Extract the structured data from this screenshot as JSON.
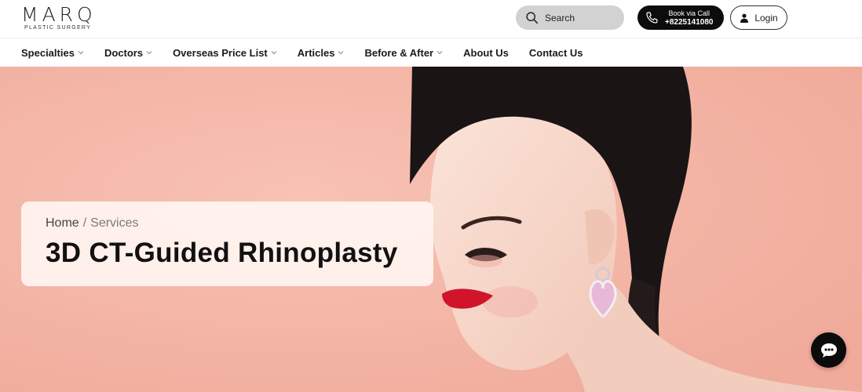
{
  "brand": {
    "name": "MARQ",
    "tagline": "PLASTIC SURGERY"
  },
  "header": {
    "search_label": "Search",
    "call_line1": "Book via Call",
    "call_number": "+8225141080",
    "login_label": "Login"
  },
  "nav": {
    "items": [
      {
        "label": "Specialties",
        "has_dropdown": true
      },
      {
        "label": "Doctors",
        "has_dropdown": true
      },
      {
        "label": "Overseas Price List",
        "has_dropdown": true
      },
      {
        "label": "Articles",
        "has_dropdown": true
      },
      {
        "label": "Before & After",
        "has_dropdown": true
      },
      {
        "label": "About Us",
        "has_dropdown": false
      },
      {
        "label": "Contact Us",
        "has_dropdown": false
      }
    ]
  },
  "hero": {
    "breadcrumb": {
      "home": "Home",
      "separator": "/",
      "current": "Services"
    },
    "title": "3D CT-Guided Rhinoplasty",
    "background_color": "#f5b6a7"
  },
  "icons": {
    "search": "search-icon",
    "phone": "phone-icon",
    "user": "user-icon",
    "chat": "chat-icon"
  }
}
